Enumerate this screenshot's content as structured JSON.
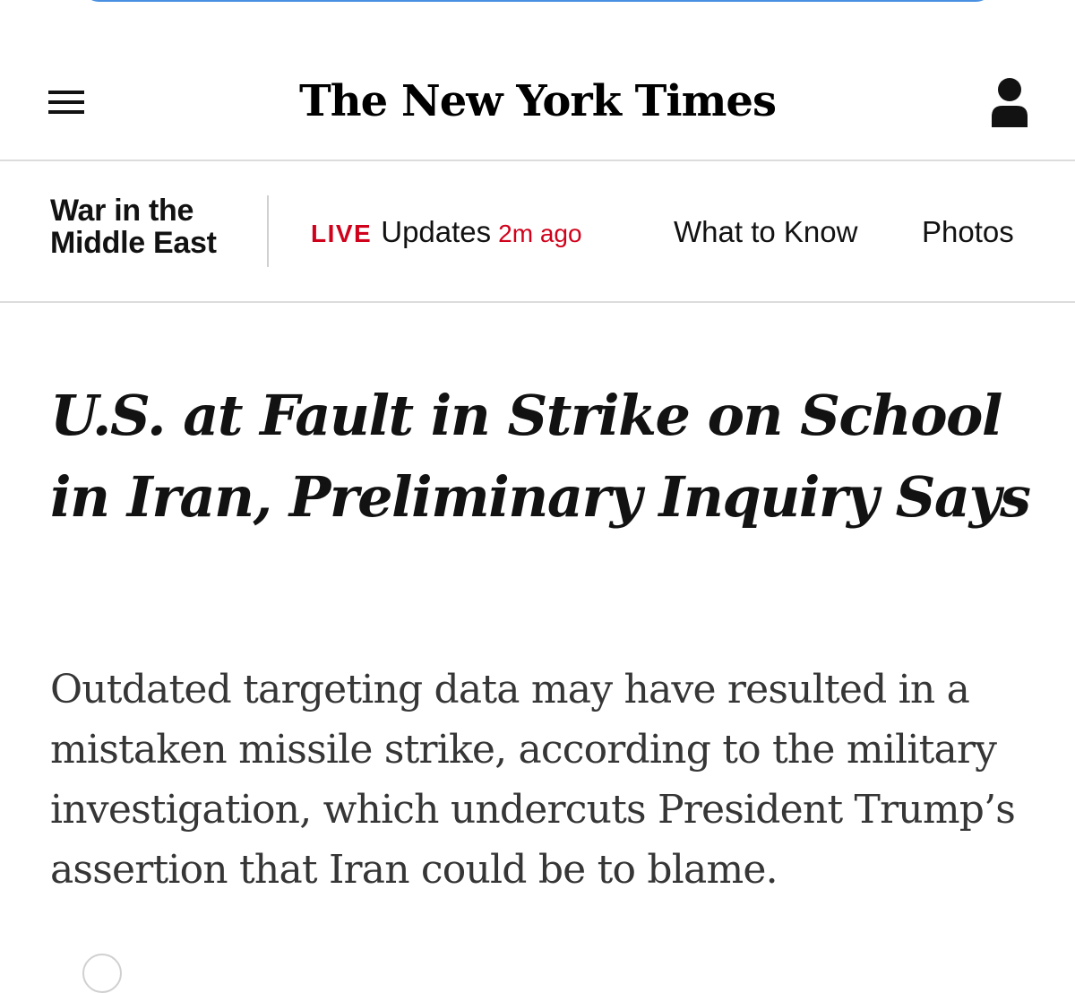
{
  "masthead": {
    "logo_text": "The New York Times",
    "menu_icon": "hamburger-menu-icon",
    "account_icon": "person-icon"
  },
  "section_nav": {
    "section_title": "War in the Middle East",
    "live": {
      "badge": "LIVE",
      "label": "Updates",
      "time": "2m ago"
    },
    "links": [
      {
        "label": "What to Know"
      },
      {
        "label": "Photos"
      }
    ]
  },
  "article": {
    "headline": "U.S. at Fault in Strike on School in Iran, Preliminary Inquiry Says",
    "summary": "Outdated targeting data may have resulted in a mistaken missile strike, according to the military investigation, which undercuts President Trump’s assertion that Iran could be to blame."
  },
  "colors": {
    "live_red": "#d0021b",
    "text": "#121212",
    "summary_text": "#363636",
    "divider": "#dcdcdc",
    "address_bar_border": "#4a90e2"
  }
}
